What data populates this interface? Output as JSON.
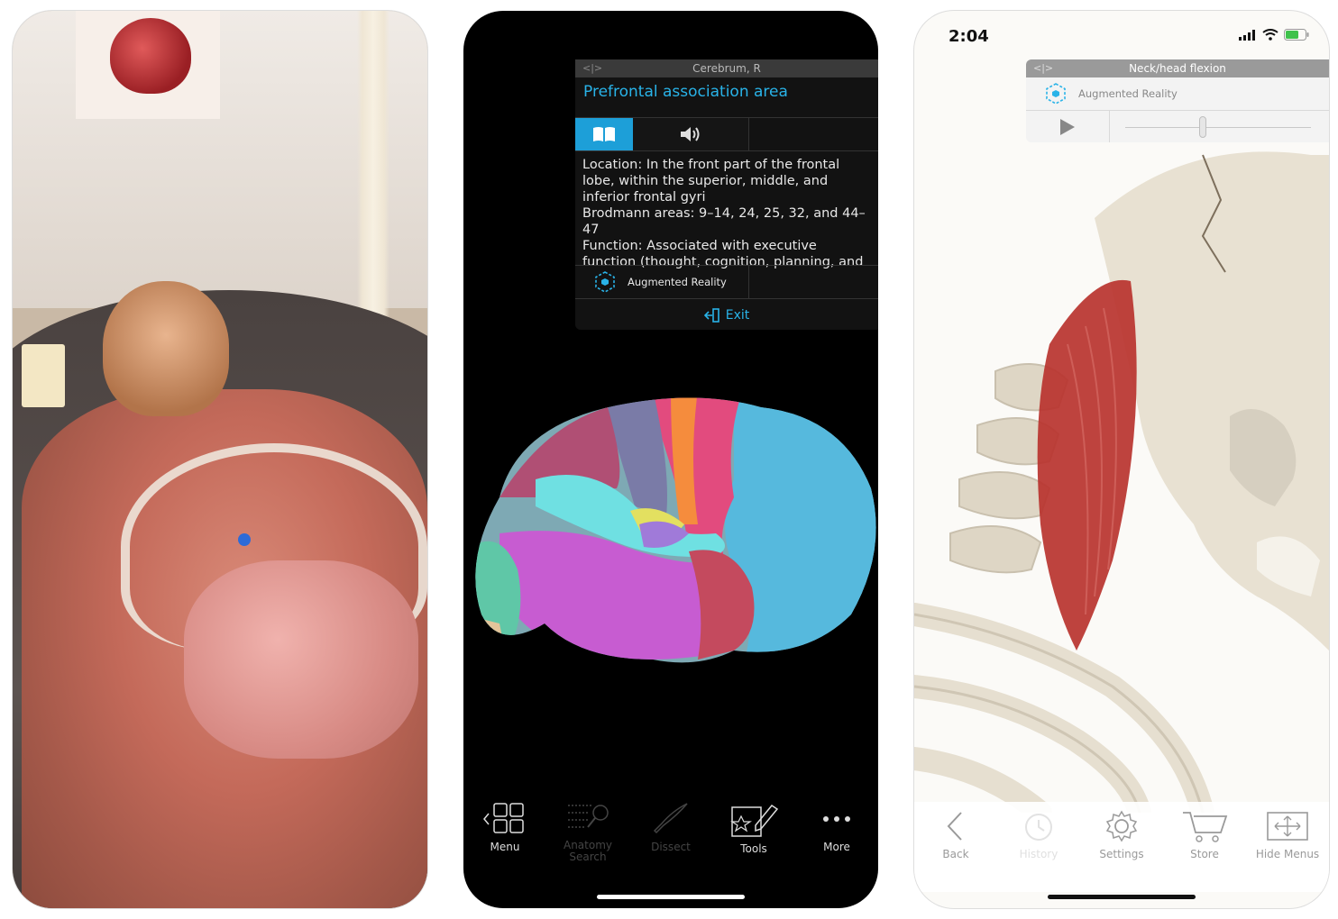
{
  "screen2": {
    "popup": {
      "header": "Cerebrum, R",
      "header_code": "<|>",
      "title": "Prefrontal association area",
      "description": "Location: In the front part of the frontal lobe, within the superior, middle, and inferior frontal gyri\nBrodmann areas: 9–14, 24, 25, 32, and 44–47\nFunction: Associated with executive function (thought, cognition, planning, and",
      "ar_label": "Augmented Reality",
      "exit_label": "Exit"
    },
    "toolbar": [
      {
        "label": "Menu",
        "icon": "menu-grid-icon",
        "enabled": true
      },
      {
        "label": "Anatomy Search",
        "icon": "search-icon",
        "enabled": false
      },
      {
        "label": "Dissect",
        "icon": "scalpel-icon",
        "enabled": false
      },
      {
        "label": "Tools",
        "icon": "tools-icon",
        "enabled": true
      },
      {
        "label": "More",
        "icon": "more-icon",
        "enabled": true
      }
    ],
    "accent_color": "#29b3e8"
  },
  "screen3": {
    "status_time": "2:04",
    "animation_panel": {
      "header": "Neck/head flexion",
      "header_code": "<|>",
      "ar_label": "Augmented Reality"
    },
    "toolbar": [
      {
        "label": "Back",
        "icon": "back-icon",
        "enabled": true
      },
      {
        "label": "History",
        "icon": "history-icon",
        "enabled": false
      },
      {
        "label": "Settings",
        "icon": "gear-icon",
        "enabled": true
      },
      {
        "label": "Store",
        "icon": "cart-icon",
        "enabled": true
      },
      {
        "label": "Hide Menus",
        "icon": "hide-menus-icon",
        "enabled": true
      }
    ]
  }
}
